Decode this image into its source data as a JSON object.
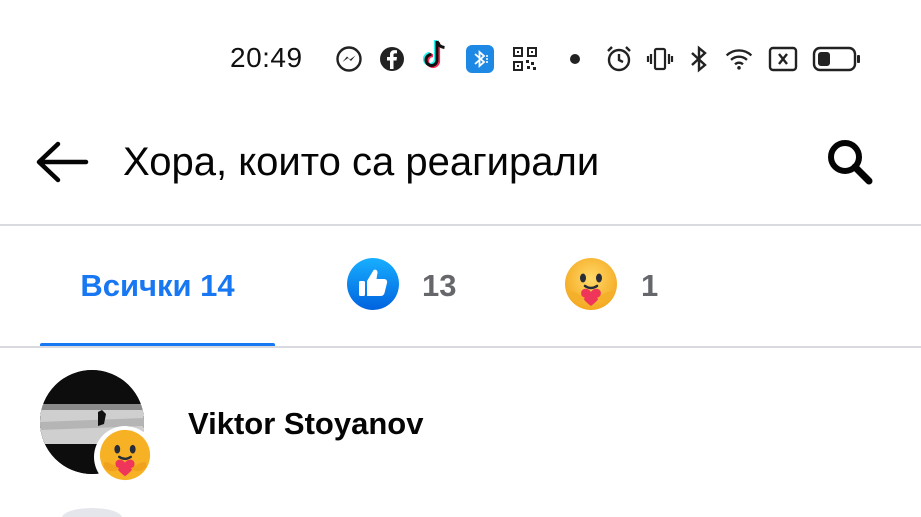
{
  "status_bar": {
    "time": "20:49",
    "icons": [
      "messenger-icon",
      "facebook-icon",
      "tiktok-icon",
      "bluetooth-app-icon",
      "qr-code-icon",
      "dot-icon",
      "alarm-icon",
      "vibrate-icon",
      "bluetooth-icon",
      "wifi-icon",
      "no-sim-icon",
      "battery-icon"
    ],
    "colors": {
      "accent_blue": "#1877f2",
      "secondary_text": "#65676b",
      "like_blue": "#1877f2",
      "care_yellow": "#f7b125"
    }
  },
  "header": {
    "title": "Хора, които са реагирали",
    "back_icon": "arrow-left-icon",
    "search_icon": "search-icon"
  },
  "tabs": {
    "all_label": "Всички 14",
    "like_count": "13",
    "care_count": "1",
    "selected": "all"
  },
  "reactors": [
    {
      "name": "Viktor Stoyanov",
      "reaction": "care"
    }
  ]
}
